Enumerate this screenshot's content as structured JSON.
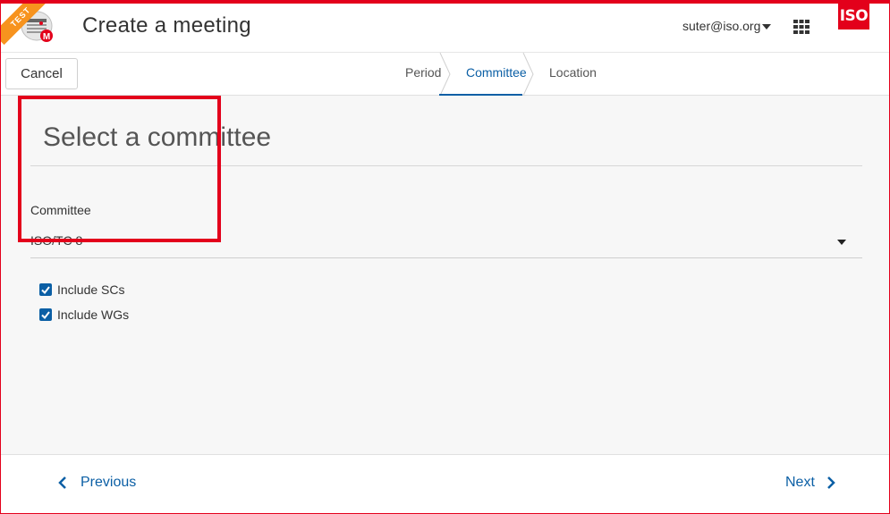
{
  "header": {
    "title": "Create a meeting",
    "badge": "TEST",
    "app_badge_letter": "M",
    "user_email": "suter@iso.org",
    "logo_text": "ISO"
  },
  "toolbar": {
    "cancel_label": "Cancel"
  },
  "steps": [
    {
      "label": "Period",
      "active": false
    },
    {
      "label": "Committee",
      "active": true
    },
    {
      "label": "Location",
      "active": false
    }
  ],
  "form": {
    "section_title": "Select a committee",
    "committee_label": "Committee",
    "committee_value": "ISO/TC 8",
    "include_scs_label": "Include SCs",
    "include_scs_checked": true,
    "include_wgs_label": "Include WGs",
    "include_wgs_checked": true
  },
  "footer": {
    "previous_label": "Previous",
    "next_label": "Next"
  },
  "colors": {
    "accent": "#0b5fa5",
    "brand_red": "#e3001b",
    "test_orange": "#f7931e",
    "content_bg": "#f7f7f7"
  },
  "icons": {
    "app_logo": "calendar-meeting-icon",
    "user_menu": "caret-down-icon",
    "apps": "grid-icon",
    "select": "caret-down-icon",
    "previous": "chevron-left-icon",
    "next": "chevron-right-icon"
  }
}
